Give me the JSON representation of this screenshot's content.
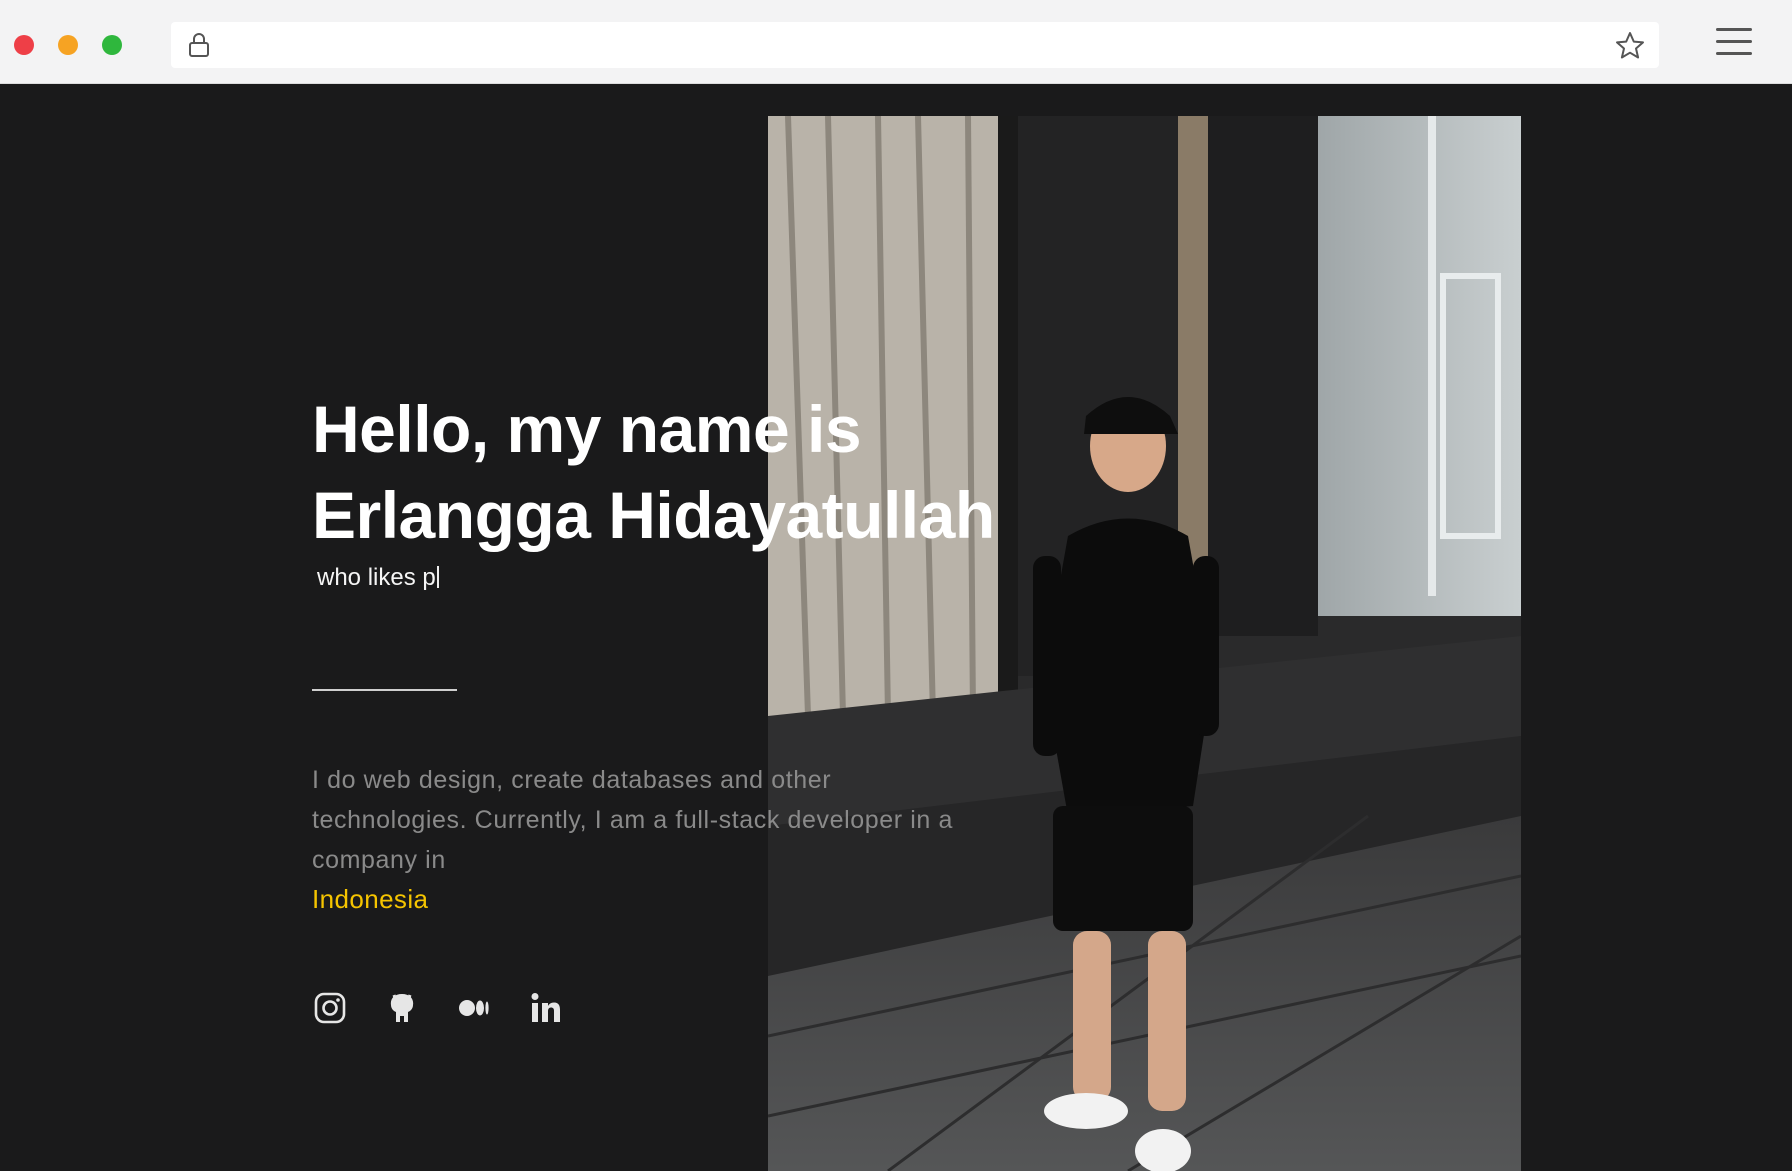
{
  "browser": {
    "address_value": "",
    "colors": {
      "close": "#ee3f47",
      "minimize": "#f6a323",
      "maximize": "#2fb73d"
    },
    "icons": [
      "lock-icon",
      "star-icon",
      "menu-icon"
    ]
  },
  "hero": {
    "title_line1": "Hello, my name is",
    "title_line2": "Erlangga Hidayatullah",
    "typed_text": "who likes p"
  },
  "bio": {
    "text": "I do web design, create databases and other technologies. Currently, I am a full-stack developer in a company in",
    "country": "Indonesia",
    "accent_color": "#f5c400"
  },
  "socials": [
    {
      "icon": "instagram-icon"
    },
    {
      "icon": "github-icon"
    },
    {
      "icon": "medium-icon"
    },
    {
      "icon": "linkedin-icon"
    }
  ]
}
